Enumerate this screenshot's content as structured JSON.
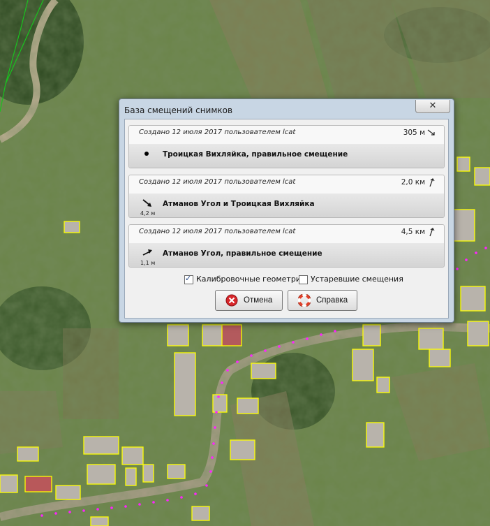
{
  "dialog": {
    "title": "База смещений снимков",
    "close_symbol": "✕"
  },
  "entries": [
    {
      "meta": "Создано 12 июля 2017 пользователем lcat",
      "distance": "305 м",
      "direction_icon": "arrow-down-right-icon",
      "name": "Троицкая Вихляйка, правильное смещение",
      "offset_icon": "dot-icon",
      "offset_value": ""
    },
    {
      "meta": "Создано 12 июля 2017 пользователем lcat",
      "distance": "2,0 км",
      "direction_icon": "arrow-up-right-icon",
      "name": "Атманов Угол и Троицкая Вихляйка",
      "offset_icon": "offset-arrow-icon",
      "offset_value": "4,2 м"
    },
    {
      "meta": "Создано 12 июля 2017 пользователем lcat",
      "distance": "4,5 км",
      "direction_icon": "arrow-up-right-icon",
      "name": "Атманов Угол, правильное смещение",
      "offset_icon": "offset-arrow-icon",
      "offset_value": "1,1 м"
    }
  ],
  "options": {
    "calibration": {
      "label": "Калибровочные геометрии",
      "checked": true
    },
    "deprecated": {
      "label": "Устаревшие смещения",
      "checked": false
    }
  },
  "buttons": {
    "cancel": "Отмена",
    "help": "Справка"
  },
  "colors": {
    "title_bar": "#c8d6e4",
    "dialog_bg": "#f0f0f0",
    "building_outline": "#ffff00",
    "road_nodes": "#ff22ff",
    "parcel_line": "#00c000"
  }
}
